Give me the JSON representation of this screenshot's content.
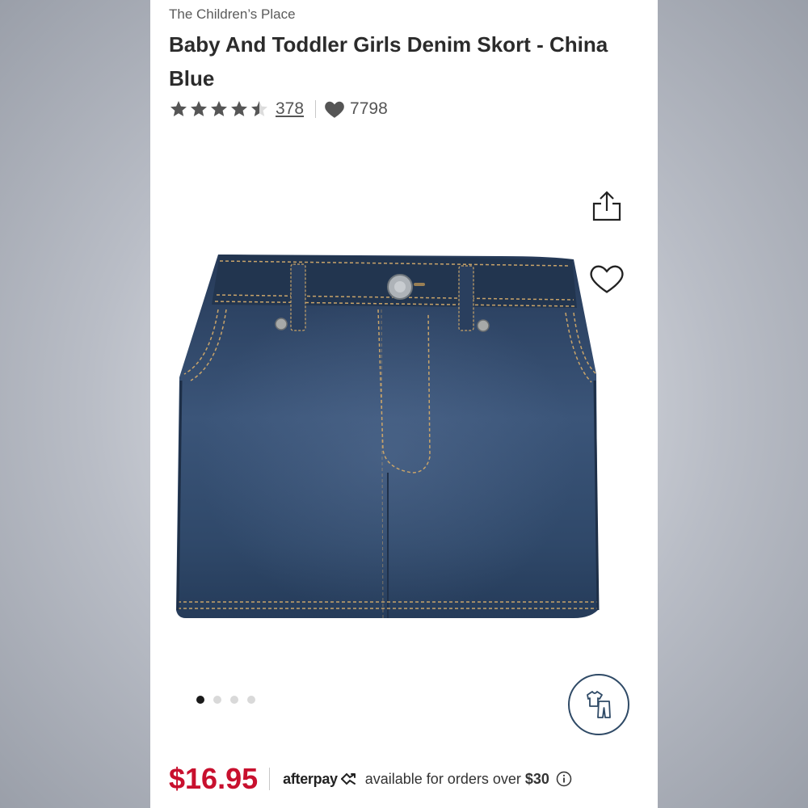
{
  "product": {
    "brand": "The Children’s Place",
    "title": "Baby And Toddler Girls Denim Skort - China Blue",
    "rating_stars": 4.5,
    "review_count": "378",
    "favorites_count": "7798",
    "price": "$16.95"
  },
  "gallery": {
    "image_count": 4,
    "active_index": 0
  },
  "afterpay": {
    "logo_text": "afterpay",
    "message": "available for orders over",
    "threshold": "$30"
  },
  "icons": {
    "share": "share-icon",
    "wishlist": "heart-outline-icon",
    "size_guide": "shirt-pants-icon",
    "info": "info-icon"
  },
  "colors": {
    "price": "#c8102e",
    "denim": "#2e4566",
    "stitching": "#c9a46a",
    "size_button_border": "#2f4a66"
  }
}
